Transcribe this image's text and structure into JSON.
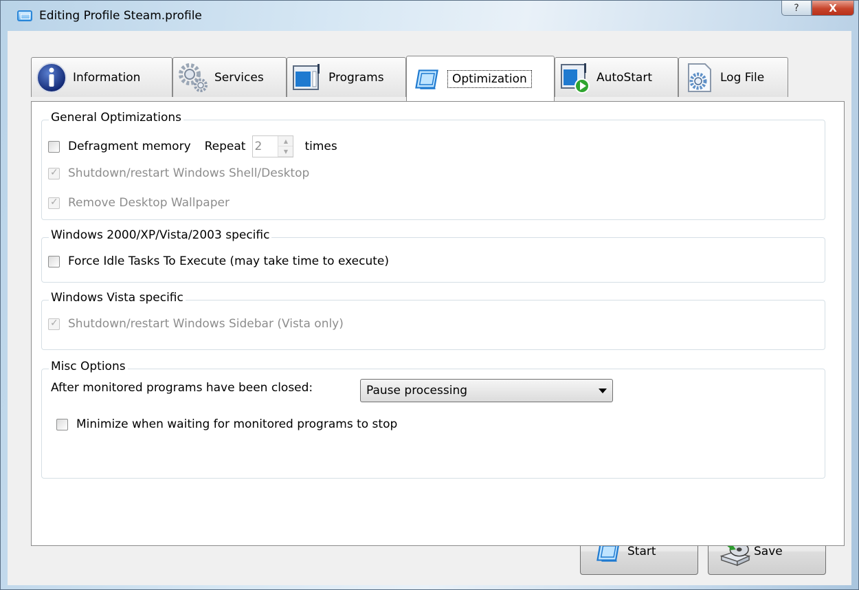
{
  "window": {
    "title": "Editing Profile Steam.profile",
    "help_label": "?",
    "close_label": "X"
  },
  "tabs": [
    {
      "label": "Information",
      "icon": "info-icon"
    },
    {
      "label": "Services",
      "icon": "gears-icon"
    },
    {
      "label": "Programs",
      "icon": "programs-icon"
    },
    {
      "label": "Optimization",
      "icon": "optimization-icon",
      "active": true
    },
    {
      "label": "AutoStart",
      "icon": "autostart-icon"
    },
    {
      "label": "Log File",
      "icon": "log-file-icon"
    }
  ],
  "general": {
    "title": "General Optimizations",
    "defrag_label": "Defragment memory",
    "repeat_label": "Repeat",
    "repeat_value": "2",
    "times_label": "times",
    "shell_label": "Shutdown/restart Windows Shell/Desktop",
    "wallpaper_label": "Remove Desktop Wallpaper"
  },
  "winxp": {
    "title": "Windows 2000/XP/Vista/2003 specific",
    "idle_label": "Force Idle Tasks To Execute (may take time to execute)"
  },
  "vista": {
    "title": "Windows Vista specific",
    "sidebar_label": "Shutdown/restart Windows Sidebar (Vista only)"
  },
  "misc": {
    "title": "Misc Options",
    "after_label": "After monitored programs have been closed:",
    "after_value": "Pause processing",
    "minimize_label": "Minimize when waiting for monitored programs to stop"
  },
  "buttons": {
    "start_label": "Start",
    "save_label": "Save"
  },
  "colors": {
    "accent": "#2a86d8",
    "close": "#c7452c"
  }
}
